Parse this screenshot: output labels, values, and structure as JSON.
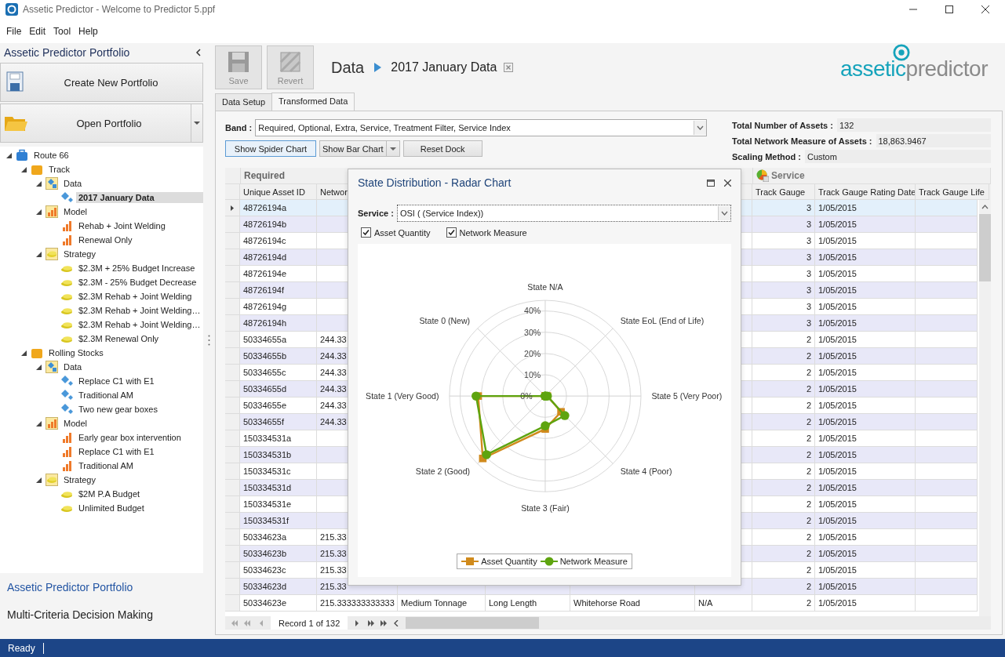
{
  "window": {
    "title": "Assetic Predictor - Welcome to Predictor 5.ppf"
  },
  "menu": [
    "File",
    "Edit",
    "Tool",
    "Help"
  ],
  "sidebar": {
    "title": "Assetic Predictor Portfolio",
    "actions": [
      {
        "label": "Create New Portfolio",
        "kind": "create"
      },
      {
        "label": "Open Portfolio",
        "kind": "open"
      }
    ],
    "tree": [
      {
        "label": "Route 66",
        "kind": "portfolio",
        "expanded": true,
        "selected": false,
        "children": [
          {
            "label": "Track",
            "kind": "folder",
            "expanded": true,
            "selected": false,
            "children": [
              {
                "label": "Data",
                "kind": "data-group",
                "expanded": true,
                "selected": false,
                "children": [
                  {
                    "label": "2017 January Data",
                    "kind": "data",
                    "selected": true
                  }
                ]
              },
              {
                "label": "Model",
                "kind": "model-group",
                "expanded": true,
                "selected": false,
                "children": [
                  {
                    "label": "Rehab + Joint Welding",
                    "kind": "model",
                    "selected": false
                  },
                  {
                    "label": "Renewal Only",
                    "kind": "model",
                    "selected": false
                  }
                ]
              },
              {
                "label": "Strategy",
                "kind": "strategy-group",
                "expanded": true,
                "selected": false,
                "children": [
                  {
                    "label": "$2.3M + 25% Budget Increase",
                    "kind": "strategy",
                    "selected": false
                  },
                  {
                    "label": "$2.3M - 25% Budget Decrease",
                    "kind": "strategy",
                    "selected": false
                  },
                  {
                    "label": "$2.3M Rehab + Joint Welding",
                    "kind": "strategy",
                    "selected": false
                  },
                  {
                    "label": "$2.3M Rehab + Joint Welding…",
                    "kind": "strategy",
                    "selected": false
                  },
                  {
                    "label": "$2.3M Rehab + Joint Welding…",
                    "kind": "strategy",
                    "selected": false
                  },
                  {
                    "label": "$2.3M Renewal Only",
                    "kind": "strategy",
                    "selected": false
                  }
                ]
              }
            ]
          },
          {
            "label": "Rolling Stocks",
            "kind": "folder",
            "expanded": true,
            "selected": false,
            "children": [
              {
                "label": "Data",
                "kind": "data-group",
                "expanded": true,
                "selected": false,
                "children": [
                  {
                    "label": "Replace C1 with E1",
                    "kind": "data",
                    "selected": false
                  },
                  {
                    "label": "Traditional AM",
                    "kind": "data",
                    "selected": false
                  },
                  {
                    "label": "Two new gear boxes",
                    "kind": "data",
                    "selected": false
                  }
                ]
              },
              {
                "label": "Model",
                "kind": "model-group",
                "expanded": true,
                "selected": false,
                "children": [
                  {
                    "label": "Early gear box intervention",
                    "kind": "model",
                    "selected": false
                  },
                  {
                    "label": "Replace C1 with E1",
                    "kind": "model",
                    "selected": false
                  },
                  {
                    "label": "Traditional AM",
                    "kind": "model",
                    "selected": false
                  }
                ]
              },
              {
                "label": "Strategy",
                "kind": "strategy-group",
                "expanded": true,
                "selected": false,
                "children": [
                  {
                    "label": "$2M P.A Budget",
                    "kind": "strategy",
                    "selected": false
                  },
                  {
                    "label": "Unlimited Budget",
                    "kind": "strategy",
                    "selected": false
                  }
                ]
              }
            ]
          }
        ]
      }
    ],
    "nav": [
      {
        "label": "Assetic Predictor Portfolio",
        "selected": true
      },
      {
        "label": "Multi-Criteria Decision Making",
        "selected": false
      }
    ]
  },
  "toolbar": [
    {
      "label": "Save",
      "kind": "save",
      "disabled": true
    },
    {
      "label": "Revert",
      "kind": "revert",
      "disabled": true
    }
  ],
  "breadcrumb": {
    "section": "Data",
    "item": "2017 January Data"
  },
  "logo": {
    "first": "assetic",
    "second": "predictor"
  },
  "tabs": [
    {
      "label": "Data Setup",
      "selected": false
    },
    {
      "label": "Transformed Data",
      "selected": true
    }
  ],
  "band": {
    "label": "Band :",
    "value": "Required, Optional, Extra, Service, Treatment Filter, Service Index"
  },
  "buttons": [
    {
      "label": "Show Spider Chart",
      "kind": "plain",
      "selected": true
    },
    {
      "label": "Show Bar Chart",
      "kind": "split",
      "selected": false
    },
    {
      "label": "Reset Dock",
      "kind": "plain",
      "selected": false
    }
  ],
  "summary": [
    {
      "label": "Total Number of Assets :",
      "value": "132"
    },
    {
      "label": "Total Network Measure of Assets :",
      "value": "18,863.9467"
    },
    {
      "label": "Scaling Method :",
      "value": "Custom"
    }
  ],
  "grid": {
    "bands": [
      "Required",
      "Service"
    ],
    "columns": {
      "id": "Unique Asset ID",
      "network": "Networ",
      "track_gauge": "Track Gauge",
      "rating_date": "Track Gauge Rating Date",
      "life": "Track Gauge Life"
    },
    "rows": [
      {
        "id": "48726194a",
        "track_gauge": "3",
        "rating_date": "1/05/2015",
        "selected": true
      },
      {
        "id": "48726194b",
        "track_gauge": "3",
        "rating_date": "1/05/2015",
        "selected": false
      },
      {
        "id": "48726194c",
        "track_gauge": "3",
        "rating_date": "1/05/2015",
        "selected": false
      },
      {
        "id": "48726194d",
        "track_gauge": "3",
        "rating_date": "1/05/2015",
        "selected": false
      },
      {
        "id": "48726194e",
        "track_gauge": "3",
        "rating_date": "1/05/2015",
        "selected": false
      },
      {
        "id": "48726194f",
        "track_gauge": "3",
        "rating_date": "1/05/2015",
        "selected": false
      },
      {
        "id": "48726194g",
        "track_gauge": "3",
        "rating_date": "1/05/2015",
        "selected": false
      },
      {
        "id": "48726194h",
        "track_gauge": "3",
        "rating_date": "1/05/2015",
        "selected": false
      },
      {
        "id": "50334655a",
        "network": "244.33",
        "track_gauge": "2",
        "rating_date": "1/05/2015",
        "selected": false
      },
      {
        "id": "50334655b",
        "network": "244.33",
        "track_gauge": "2",
        "rating_date": "1/05/2015",
        "selected": false
      },
      {
        "id": "50334655c",
        "network": "244.33",
        "track_gauge": "2",
        "rating_date": "1/05/2015",
        "selected": false
      },
      {
        "id": "50334655d",
        "network": "244.33",
        "track_gauge": "2",
        "rating_date": "1/05/2015",
        "selected": false
      },
      {
        "id": "50334655e",
        "network": "244.33",
        "track_gauge": "2",
        "rating_date": "1/05/2015",
        "selected": false
      },
      {
        "id": "50334655f",
        "network": "244.33",
        "track_gauge": "2",
        "rating_date": "1/05/2015",
        "selected": false
      },
      {
        "id": "150334531a",
        "track_gauge": "2",
        "rating_date": "1/05/2015",
        "selected": false
      },
      {
        "id": "150334531b",
        "track_gauge": "2",
        "rating_date": "1/05/2015",
        "selected": false
      },
      {
        "id": "150334531c",
        "track_gauge": "2",
        "rating_date": "1/05/2015",
        "selected": false
      },
      {
        "id": "150334531d",
        "track_gauge": "2",
        "rating_date": "1/05/2015",
        "selected": false
      },
      {
        "id": "150334531e",
        "track_gauge": "2",
        "rating_date": "1/05/2015",
        "selected": false
      },
      {
        "id": "150334531f",
        "track_gauge": "2",
        "rating_date": "1/05/2015",
        "selected": false
      },
      {
        "id": "50334623a",
        "network": "215.33",
        "track_gauge": "2",
        "rating_date": "1/05/2015",
        "selected": false
      },
      {
        "id": "50334623b",
        "network": "215.33",
        "track_gauge": "2",
        "rating_date": "1/05/2015",
        "selected": false
      },
      {
        "id": "50334623c",
        "network": "215.33",
        "track_gauge": "2",
        "rating_date": "1/05/2015",
        "selected": false
      },
      {
        "id": "50334623d",
        "network": "215.33",
        "track_gauge": "2",
        "rating_date": "1/05/2015",
        "selected": false
      },
      {
        "id": "50334623e",
        "network": "215.333333333333",
        "middle": [
          "Medium Tonnage",
          "Long Length",
          "Whitehorse Road",
          "N/A"
        ],
        "track_gauge": "2",
        "rating_date": "1/05/2015",
        "selected": false
      }
    ],
    "pager": "Record 1 of 132"
  },
  "dialog": {
    "title": "State Distribution - Radar Chart",
    "service_label": "Service :",
    "service_value": "OSI ( (Service Index))",
    "checks": [
      {
        "label": "Asset Quantity",
        "checked": true
      },
      {
        "label": "Network Measure",
        "checked": true
      }
    ],
    "radar": {
      "axes": [
        "State N/A",
        "State EoL (End of Life)",
        "State 5 (Very Poor)",
        "State 4 (Poor)",
        "State 3 (Fair)",
        "State 2 (Good)",
        "State 1 (Very Good)",
        "State 0 (New)"
      ],
      "ticks": [
        "40%",
        "30%",
        "20%",
        "10%",
        "0%"
      ],
      "legend": [
        {
          "name": "Asset Quantity",
          "color": "#d08a1c",
          "kind": "square"
        },
        {
          "name": "Network Measure",
          "color": "#5ea40f",
          "kind": "circle"
        }
      ]
    }
  },
  "status_bar": "Ready"
}
